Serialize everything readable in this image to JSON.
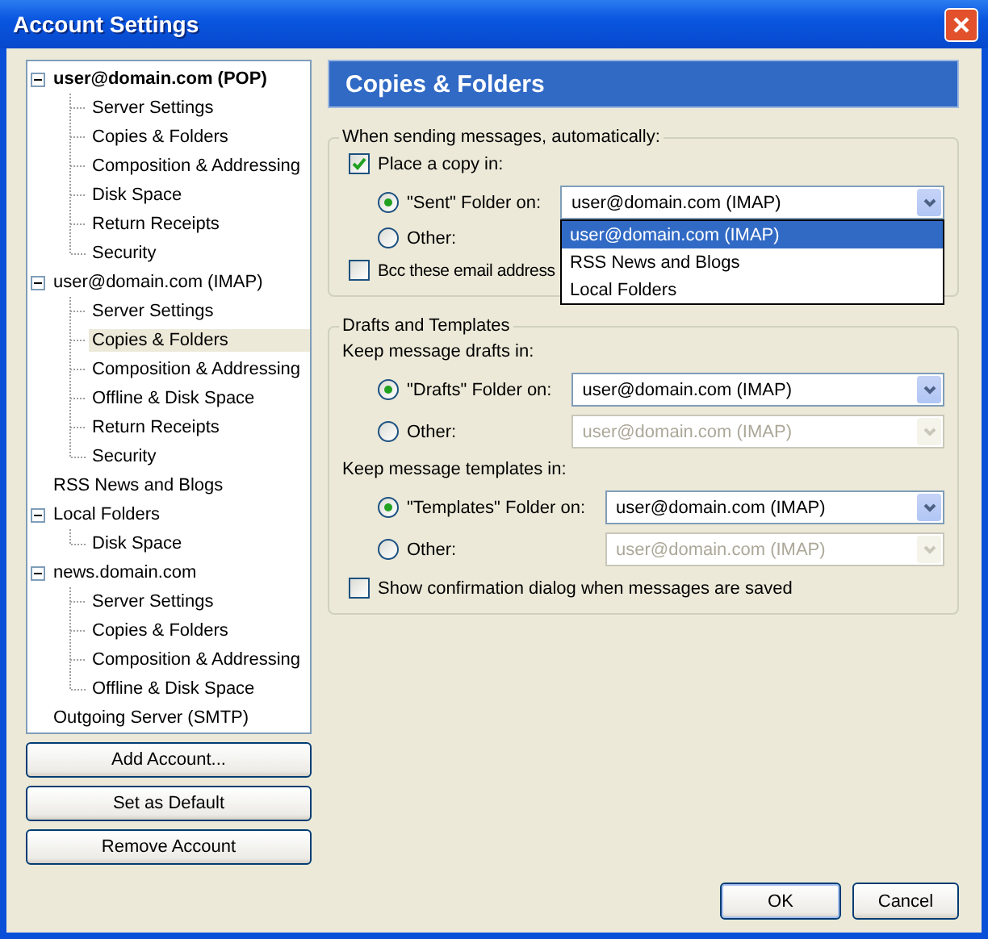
{
  "window": {
    "title": "Account Settings"
  },
  "sidebar": {
    "tree": [
      {
        "label": "user@domain.com  (POP)",
        "bold": true,
        "expanded": true,
        "selected": false,
        "children": [
          {
            "label": "Server Settings",
            "selected": false
          },
          {
            "label": "Copies & Folders",
            "selected": false
          },
          {
            "label": "Composition & Addressing",
            "selected": false
          },
          {
            "label": "Disk Space",
            "selected": false
          },
          {
            "label": "Return Receipts",
            "selected": false
          },
          {
            "label": "Security",
            "selected": false
          }
        ]
      },
      {
        "label": "user@domain.com  (IMAP)",
        "bold": false,
        "expanded": true,
        "selected": false,
        "children": [
          {
            "label": "Server Settings",
            "selected": false
          },
          {
            "label": "Copies & Folders",
            "selected": true
          },
          {
            "label": "Composition & Addressing",
            "selected": false
          },
          {
            "label": "Offline & Disk Space",
            "selected": false
          },
          {
            "label": "Return Receipts",
            "selected": false
          },
          {
            "label": "Security",
            "selected": false
          }
        ]
      },
      {
        "label": "RSS News and Blogs",
        "bold": false,
        "selected": false
      },
      {
        "label": "Local Folders",
        "bold": false,
        "expanded": true,
        "selected": false,
        "children": [
          {
            "label": "Disk Space",
            "selected": false
          }
        ]
      },
      {
        "label": "news.domain.com",
        "bold": false,
        "expanded": true,
        "selected": false,
        "children": [
          {
            "label": "Server Settings",
            "selected": false
          },
          {
            "label": "Copies & Folders",
            "selected": false
          },
          {
            "label": "Composition & Addressing",
            "selected": false
          },
          {
            "label": "Offline & Disk Space",
            "selected": false
          }
        ]
      },
      {
        "label": "Outgoing Server (SMTP)",
        "bold": false,
        "selected": false
      }
    ],
    "buttons": [
      "Add Account...",
      "Set as Default",
      "Remove Account"
    ]
  },
  "panel": {
    "header": "Copies & Folders",
    "sending": {
      "legend": "When sending messages, automatically:",
      "place_copy": {
        "label": "Place a copy in:",
        "checked": true
      },
      "options": [
        {
          "label": "\"Sent\" Folder on:",
          "selected": true,
          "select": {
            "value": "user@domain.com  (IMAP)",
            "disabled": false,
            "open": true,
            "items": [
              {
                "label": "user@domain.com  (IMAP)",
                "selected": true
              },
              {
                "label": "RSS News and Blogs",
                "selected": false
              },
              {
                "label": "Local Folders",
                "selected": false
              }
            ]
          }
        },
        {
          "label": "Other:",
          "selected": false
        }
      ],
      "bcc": {
        "label": "Bcc these email address",
        "checked": false
      }
    },
    "drafts": {
      "legend": "Drafts and Templates",
      "sections": [
        {
          "heading": "Keep message drafts in:",
          "options": [
            {
              "label": "\"Drafts\" Folder on:",
              "selected": true,
              "select": {
                "value": "user@domain.com  (IMAP)",
                "disabled": false
              }
            },
            {
              "label": "Other:",
              "selected": false,
              "select": {
                "value": "user@domain.com  (IMAP)",
                "disabled": true
              }
            }
          ]
        },
        {
          "heading": "Keep message templates in:",
          "options": [
            {
              "label": "\"Templates\" Folder on:",
              "selected": true,
              "select": {
                "value": "user@domain.com  (IMAP)",
                "disabled": false
              }
            },
            {
              "label": "Other:",
              "selected": false,
              "select": {
                "value": "user@domain.com  (IMAP)",
                "disabled": true
              }
            }
          ]
        }
      ],
      "confirm": {
        "label": "Show confirmation dialog when messages are saved",
        "checked": false
      }
    }
  },
  "footer": {
    "buttons": [
      "OK",
      "Cancel"
    ]
  }
}
